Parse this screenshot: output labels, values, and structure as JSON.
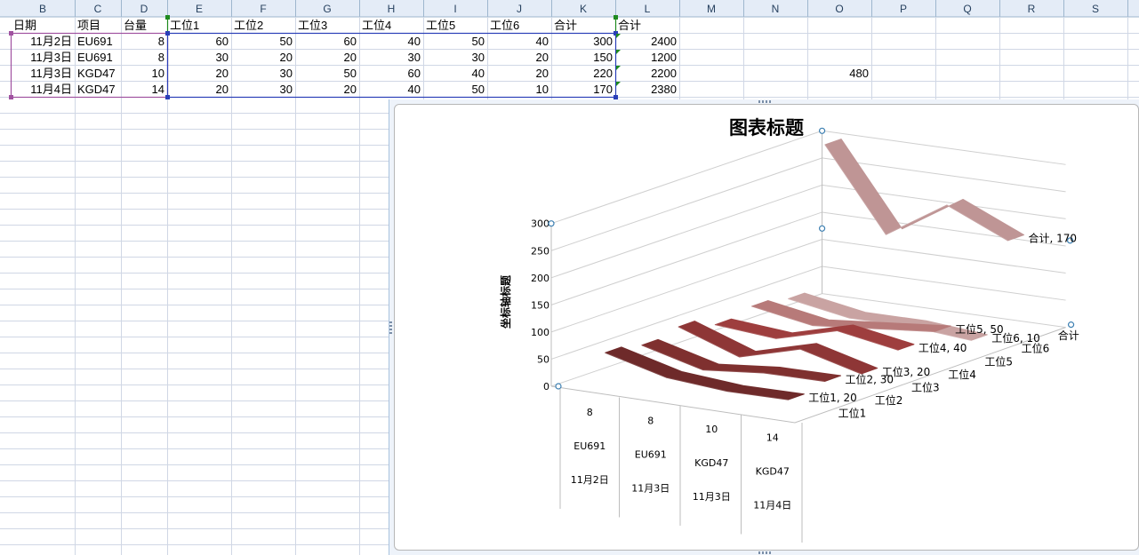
{
  "columns": [
    "B",
    "C",
    "D",
    "E",
    "F",
    "G",
    "H",
    "I",
    "J",
    "K",
    "L",
    "M",
    "N",
    "O",
    "P",
    "Q",
    "R",
    "S"
  ],
  "header_row": [
    "日期",
    "项目",
    "台量",
    "工位1",
    "工位2",
    "工位3",
    "工位4",
    "工位5",
    "工位6",
    "合计",
    "合计"
  ],
  "rows": [
    [
      "11月2日",
      "EU691",
      "8",
      "60",
      "50",
      "60",
      "40",
      "50",
      "40",
      "300",
      "2400"
    ],
    [
      "11月3日",
      "EU691",
      "8",
      "30",
      "20",
      "20",
      "30",
      "30",
      "20",
      "150",
      "1200"
    ],
    [
      "11月3日",
      "KGD47",
      "10",
      "20",
      "30",
      "50",
      "60",
      "40",
      "20",
      "220",
      "2200"
    ],
    [
      "11月4日",
      "KGD47",
      "14",
      "20",
      "30",
      "20",
      "40",
      "50",
      "10",
      "170",
      "2380"
    ]
  ],
  "extra_cell": {
    "column": "O",
    "row": 3,
    "value": "480"
  },
  "chart_data": {
    "type": "line-3d",
    "title": "图表标题",
    "ylabel": "坐标轴标题",
    "ylim": [
      0,
      300
    ],
    "yticks": [
      "0",
      "50",
      "100",
      "150",
      "200",
      "250",
      "300"
    ],
    "categories": [
      [
        "8",
        "EU691",
        "11月2日"
      ],
      [
        "8",
        "EU691",
        "11月3日"
      ],
      [
        "10",
        "KGD47",
        "11月3日"
      ],
      [
        "14",
        "KGD47",
        "11月4日"
      ]
    ],
    "depth_labels": [
      "工位1",
      "工位2",
      "工位3",
      "工位4",
      "工位5",
      "工位6",
      "合计"
    ],
    "series": [
      {
        "name": "工位1",
        "values": [
          60,
          30,
          20,
          20
        ],
        "color": "#6e2a2a",
        "data_label": "工位1, 20"
      },
      {
        "name": "工位2",
        "values": [
          50,
          20,
          30,
          30
        ],
        "color": "#7f302f",
        "data_label": "工位2, 30"
      },
      {
        "name": "工位3",
        "values": [
          60,
          20,
          50,
          20
        ],
        "color": "#8e3636",
        "data_label": "工位3, 20"
      },
      {
        "name": "工位4",
        "values": [
          40,
          30,
          60,
          40
        ],
        "color": "#9e3e3e",
        "data_label": "工位4, 40"
      },
      {
        "name": "工位5",
        "values": [
          50,
          30,
          40,
          50
        ],
        "color": "#b77a79",
        "data_label": "工位5, 50"
      },
      {
        "name": "工位6",
        "values": [
          40,
          20,
          20,
          10
        ],
        "color": "#c9a3a2",
        "data_label": "工位6, 10"
      },
      {
        "name": "合计",
        "values": [
          300,
          150,
          220,
          170
        ],
        "color": "#bf9595",
        "data_label": "合计, 170"
      }
    ]
  }
}
